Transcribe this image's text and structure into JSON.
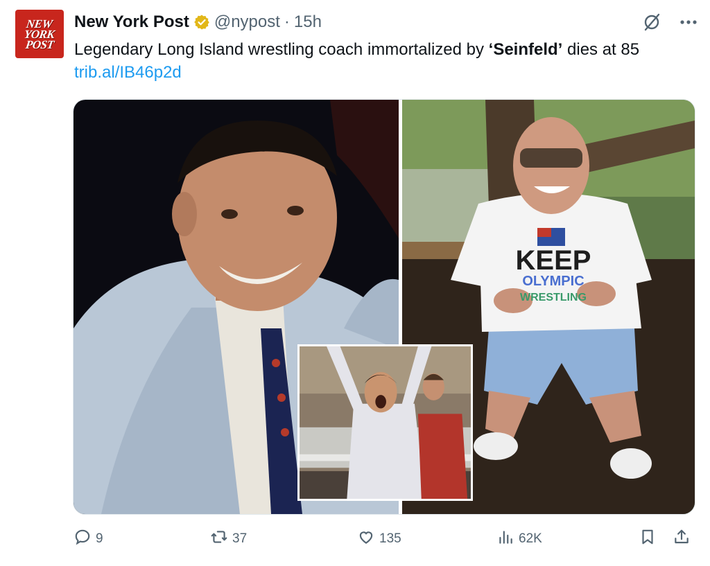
{
  "avatar": {
    "logo_lines": [
      "NEW",
      "YORK",
      "POST"
    ]
  },
  "author": {
    "display_name": "New York Post",
    "handle": "@nypost",
    "separator": "·",
    "time": "15h"
  },
  "tweet": {
    "text_before": "Legendary Long Island wrestling coach immortalized by ",
    "text_bold": "‘Seinfeld’",
    "text_after": " dies at 85 ",
    "link": "trib.al/IB46p2d"
  },
  "media": {
    "images": [
      {
        "name": "coach-portrait-photo"
      },
      {
        "name": "coach-crouching-photo",
        "shirt_lines": [
          "KEEP",
          "OLYMPIC",
          "WRESTLING"
        ]
      },
      {
        "name": "seinfeld-scene-inset"
      }
    ]
  },
  "actions": {
    "replies": "9",
    "reposts": "37",
    "likes": "135",
    "views": "62K"
  },
  "colors": {
    "accent": "#1d9bf0",
    "muted": "#536471",
    "verified": "#e2b719",
    "logo_bg": "#c8261d"
  },
  "icons": [
    "verified-badge-icon",
    "grok-icon",
    "more-icon",
    "reply-icon",
    "repost-icon",
    "like-icon",
    "views-icon",
    "bookmark-icon",
    "share-icon"
  ]
}
